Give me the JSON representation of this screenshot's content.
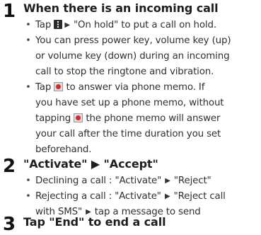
{
  "steps": [
    {
      "number": "1",
      "heading": "When there is an incoming call",
      "bullets": [
        {
          "lines": [
            "Tap",
            "\"On hold\" to put a call on hold."
          ]
        },
        {
          "lines": [
            "You can press power key, volume key (up)",
            "or volume key (down) during an incoming",
            "call to stop the ringtone and vibration."
          ]
        },
        {
          "lines": [
            "Tap",
            "to answer via phone memo. If",
            "you have set up a phone memo, without",
            "tapping",
            "the phone memo will answer",
            "your call after the time duration you set",
            "beforehand."
          ]
        }
      ]
    },
    {
      "number": "2",
      "heading": "\"Activate\" ▶ \"Accept\"",
      "bullets": [
        {
          "lines": [
            "Declining a call : \"Activate\"",
            "\"Reject\""
          ]
        },
        {
          "lines": [
            "Rejecting a call : \"Activate\"",
            "\"Reject call",
            "with SMS\"",
            "tap a message to send"
          ]
        }
      ]
    },
    {
      "number": "3",
      "heading": "Tap \"End\" to end a call"
    }
  ],
  "icons": {
    "menu": "menu-icon",
    "phone_memo": "phone-memo-icon",
    "arrow": "▶"
  }
}
